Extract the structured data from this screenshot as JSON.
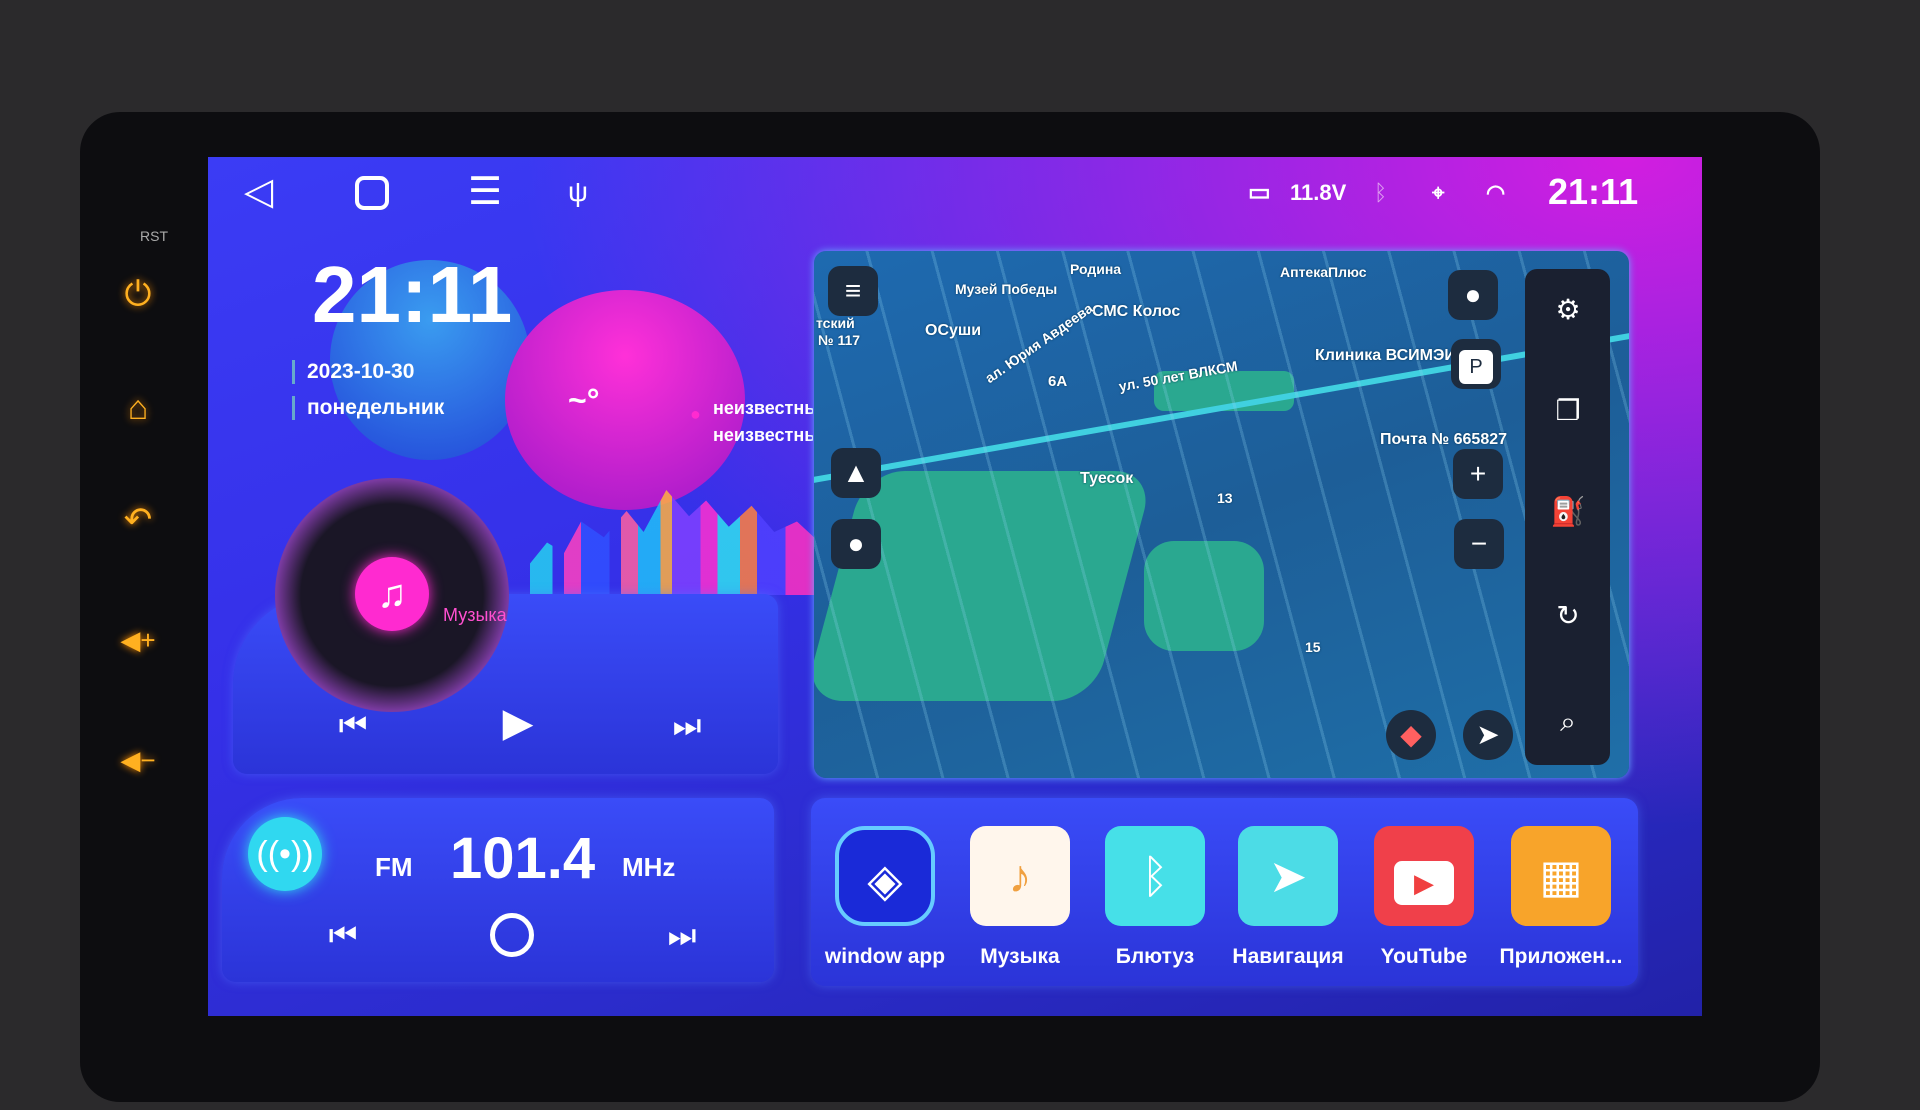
{
  "bezel": {
    "rst_label": "RST"
  },
  "navbar": {
    "back_icon": "triangle-back",
    "home_icon": "square-home",
    "menu_icon": "hamburger",
    "usb_icon": "usb"
  },
  "status": {
    "battery_voltage": "11.8V",
    "time": "21:11",
    "icons": [
      "battery",
      "bluetooth",
      "location",
      "wifi"
    ]
  },
  "clock": {
    "time": "21:11",
    "date": "2023-10-30",
    "weekday": "понедельник"
  },
  "weather": {
    "temp": "~°",
    "location_line1": "неизвестны",
    "location_line2": "неизвестны"
  },
  "music": {
    "label": "Музыка"
  },
  "radio": {
    "band": "FM",
    "frequency": "101.4",
    "unit": "MHz"
  },
  "map": {
    "labels": {
      "museum": "Музей Победы",
      "rodina": "Родина",
      "apteka": "АптекаПлюс",
      "kolos": "СМС Колос",
      "osushi": "ОСуши",
      "school_a": "тский",
      "school_b": "№ 117",
      "street1": "ал. Юрия Авдеева",
      "house6a": "6А",
      "street2": "ул. 50 лет ВЛКСМ",
      "clinic": "Клиника ВСИМЭИ",
      "post": "Почта № 665827",
      "tuesok": "Туесок",
      "h13": "13",
      "h15": "15"
    },
    "parking": "P"
  },
  "apps": [
    {
      "label": "window app",
      "color": "#1a2ad8"
    },
    {
      "label": "Музыка",
      "color": "#fff6ec"
    },
    {
      "label": "Блютуз",
      "color": "#46e0e8"
    },
    {
      "label": "Навигация",
      "color": "#4cdce6"
    },
    {
      "label": "YouTube",
      "color": "#f0404a"
    },
    {
      "label": "Приложен...",
      "color": "#f8a42a"
    }
  ],
  "colors": {
    "accent_pink": "#ff2ad0",
    "side_buttons": "#ffb020"
  }
}
